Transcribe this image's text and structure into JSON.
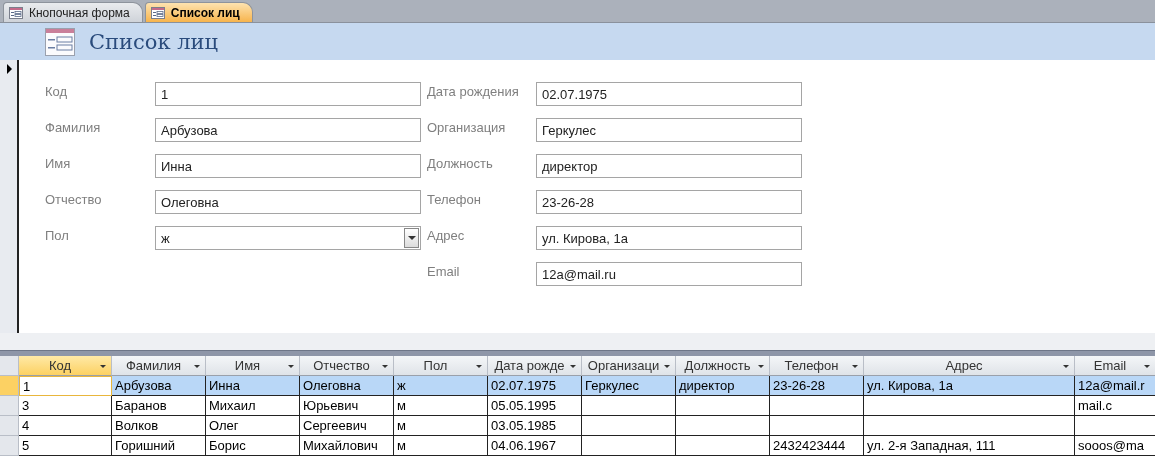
{
  "tabs": [
    {
      "label": "Кнопочная форма",
      "selected": false
    },
    {
      "label": "Список лиц",
      "selected": true
    }
  ],
  "form_header": {
    "title": "Список лиц"
  },
  "form": {
    "left": [
      {
        "label": "Код",
        "value": "1",
        "kind": "text"
      },
      {
        "label": "Фамилия",
        "value": "Арбузова",
        "kind": "text"
      },
      {
        "label": "Имя",
        "value": "Инна",
        "kind": "text"
      },
      {
        "label": "Отчество",
        "value": "Олеговна",
        "kind": "text"
      },
      {
        "label": "Пол",
        "value": "ж",
        "kind": "combo"
      }
    ],
    "right": [
      {
        "label": "Дата рождения",
        "value": "02.07.1975"
      },
      {
        "label": "Организация",
        "value": "Геркулес"
      },
      {
        "label": "Должность",
        "value": "директор"
      },
      {
        "label": "Телефон",
        "value": "23-26-28"
      },
      {
        "label": "Адрес",
        "value": "ул. Кирова, 1а"
      },
      {
        "label": "Email",
        "value": "12a@mail.ru"
      }
    ]
  },
  "datasheet": {
    "columns": [
      {
        "label": "Код",
        "selected": true
      },
      {
        "label": "Фамилия",
        "selected": false
      },
      {
        "label": "Имя",
        "selected": false
      },
      {
        "label": "Отчество",
        "selected": false
      },
      {
        "label": "Пол",
        "selected": false
      },
      {
        "label": "Дата рожде",
        "selected": false
      },
      {
        "label": "Организаци",
        "selected": false
      },
      {
        "label": "Должность",
        "selected": false
      },
      {
        "label": "Телефон",
        "selected": false
      },
      {
        "label": "Адрес",
        "selected": false
      },
      {
        "label": "Email",
        "selected": false
      }
    ],
    "rows": [
      {
        "selected": true,
        "cells": [
          "1",
          "Арбузова",
          "Инна",
          "Олеговна",
          "ж",
          "02.07.1975",
          "Геркулес",
          "директор",
          "23-26-28",
          "ул. Кирова, 1а",
          "12a@mail.r"
        ]
      },
      {
        "selected": false,
        "cells": [
          "3",
          "Баранов",
          "Михаил",
          "Юрьевич",
          "м",
          "05.05.1995",
          "",
          "",
          "",
          "",
          "mail.c"
        ]
      },
      {
        "selected": false,
        "cells": [
          "4",
          "Волков",
          "Олег",
          "Сергеевич",
          "м",
          "03.05.1985",
          "",
          "",
          "",
          "",
          ""
        ]
      },
      {
        "selected": false,
        "cells": [
          "5",
          "Горишний",
          "Борис",
          "Михайлович",
          "м",
          "04.06.1967",
          "",
          "",
          "2432423444",
          "ул. 2-я Западная, 111",
          "sooos@ma"
        ]
      }
    ]
  }
}
